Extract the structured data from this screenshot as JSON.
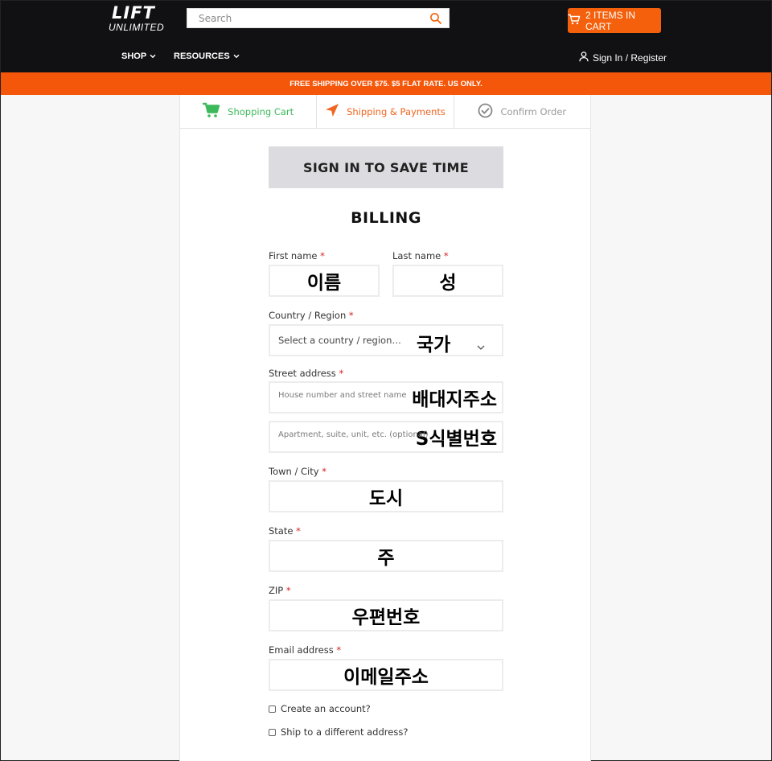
{
  "header": {
    "logo_top": "LIFT",
    "logo_bottom": "UNLIMITED",
    "search_placeholder": "Search",
    "cart_label": "2 ITEMS IN CART",
    "nav": [
      {
        "label": "SHOP"
      },
      {
        "label": "RESOURCES"
      }
    ],
    "signin_label": "Sign In / Register"
  },
  "banner": {
    "text": "FREE SHIPPING OVER $75. $5 FLAT RATE. US ONLY."
  },
  "steps": [
    {
      "label": "Shopping Cart"
    },
    {
      "label": "Shipping & Payments"
    },
    {
      "label": "Confirm Order"
    }
  ],
  "signin_save": "SIGN IN TO SAVE TIME",
  "billing": {
    "title": "BILLING",
    "required_mark": "*",
    "first_name": {
      "label": "First name",
      "value": "이름"
    },
    "last_name": {
      "label": "Last name",
      "value": "성"
    },
    "country": {
      "label": "Country / Region",
      "placeholder": "Select a country / region…",
      "value": "국가"
    },
    "street": {
      "label": "Street address",
      "placeholder": "House number and street name",
      "value": "배대지주소"
    },
    "apartment": {
      "placeholder": "Apartment, suite, unit, etc. (optional)",
      "value": "S식별번호"
    },
    "city": {
      "label": "Town / City",
      "value": "도시"
    },
    "state": {
      "label": "State",
      "value": "주"
    },
    "zip": {
      "label": "ZIP",
      "value": "우편번호"
    },
    "email": {
      "label": "Email address",
      "value": "이메일주소"
    },
    "create_account": "Create an account?",
    "ship_different": "Ship to a different address?"
  },
  "colors": {
    "brand_orange": "#f4600c",
    "header_bg": "#111113",
    "step_done": "#3cb95b",
    "step_active": "#f0651f",
    "step_pending": "#9a9a9a"
  }
}
